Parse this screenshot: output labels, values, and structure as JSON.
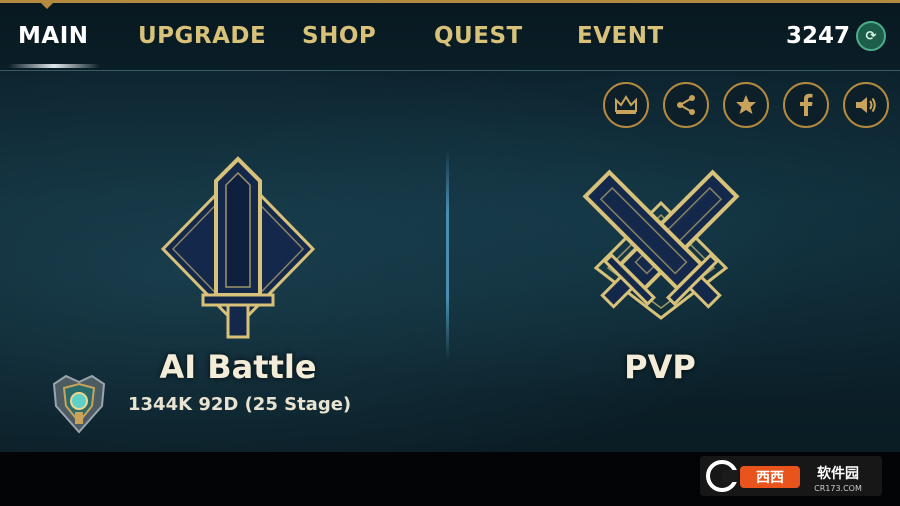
{
  "nav": {
    "tabs": [
      "MAIN",
      "UPGRADE",
      "SHOP",
      "QUEST",
      "EVENT"
    ],
    "active": "MAIN"
  },
  "currency": {
    "amount": "3247",
    "icon": "coin-icon"
  },
  "action_icons": [
    "crown-icon",
    "share-icon",
    "star-icon",
    "facebook-icon",
    "sound-icon"
  ],
  "modes": {
    "ai_battle": {
      "label": "AI Battle",
      "stage": "1344K 92D (25 Stage)",
      "icon": "sword-icon"
    },
    "pvp": {
      "label": "PVP",
      "icon": "crossed-swords-icon"
    }
  },
  "rank_badge": {
    "icon": "rank-shield-icon"
  },
  "watermark": {
    "brand": "西西软件园",
    "site": "CR173.COM"
  },
  "colors": {
    "gold": "#b48a3e",
    "nav_text": "#d8c27a",
    "active_text": "#ffffff",
    "panel_dark": "#0b1f29",
    "sword_fill": "#13284a"
  }
}
